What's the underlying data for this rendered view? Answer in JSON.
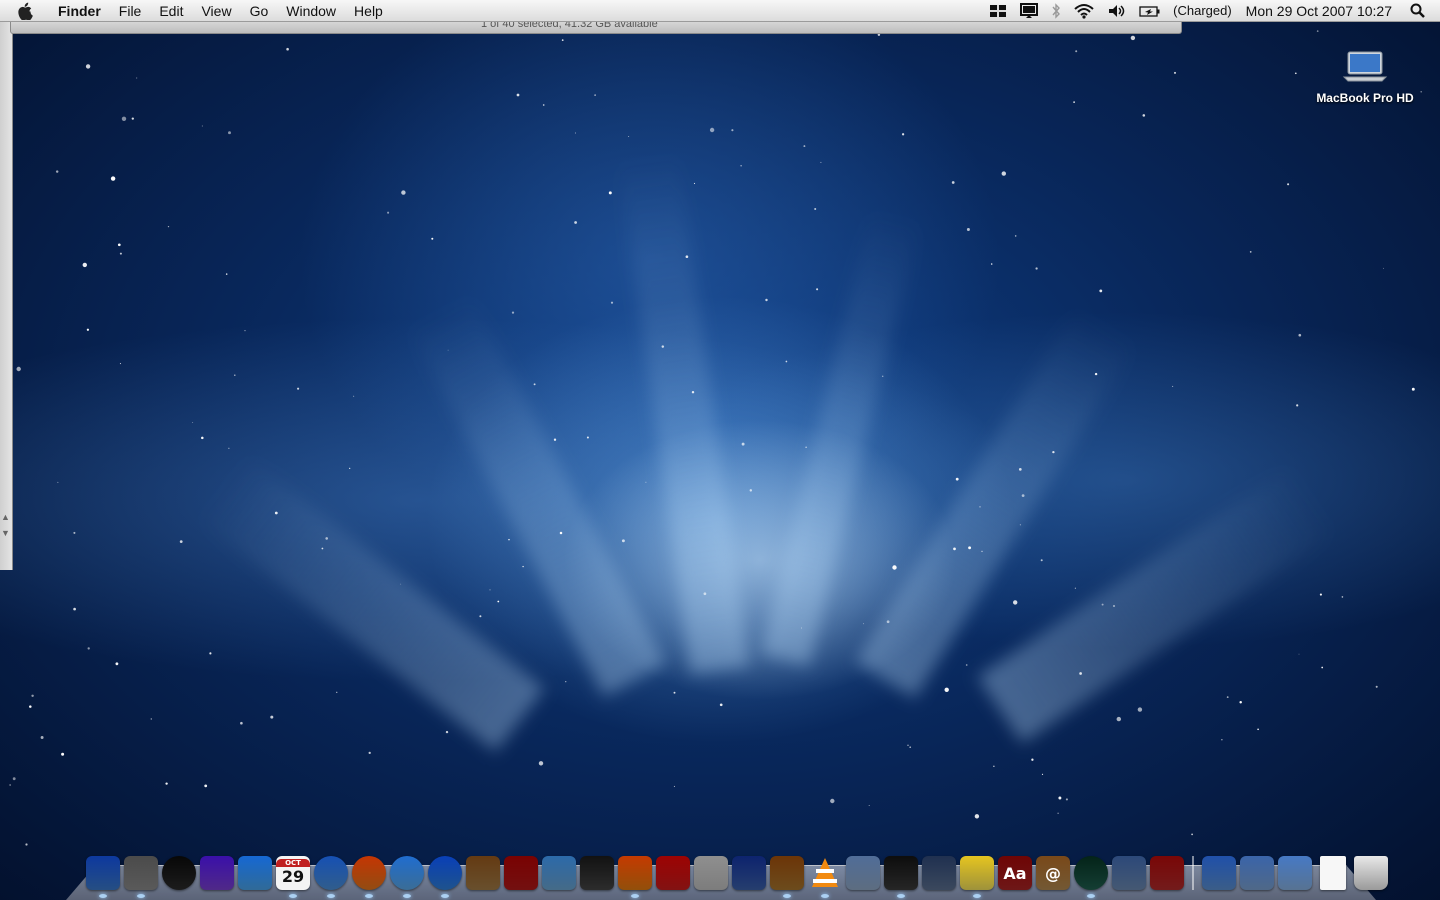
{
  "menubar": {
    "apple_icon": "apple-icon",
    "app_name": "Finder",
    "menus": [
      "File",
      "Edit",
      "View",
      "Go",
      "Window",
      "Help"
    ],
    "battery_status": "(Charged)",
    "clock": "Mon 29 Oct 2007 10:27",
    "status_icons": [
      "spaces-icon",
      "display-icon",
      "bluetooth-icon",
      "wifi-icon",
      "volume-icon",
      "battery-icon",
      "spotlight-icon"
    ]
  },
  "finder_window": {
    "status_text": "1 of 40 selected, 41.32 GB available"
  },
  "desktop": {
    "hd_label": "MacBook Pro HD"
  },
  "dock": {
    "calendar_day": "29",
    "calendar_month": "OCT",
    "dictionary_text": "Aa",
    "address_book_text": "@",
    "apps": [
      {
        "name": "finder-icon",
        "color": "#3a78c9"
      },
      {
        "name": "system-preferences-icon",
        "color": "#8a8a8a"
      },
      {
        "name": "dashboard-icon",
        "color": "#2b2b2b"
      },
      {
        "name": "app-e-icon",
        "color": "#7a3fd0"
      },
      {
        "name": "app-w-icon",
        "color": "#4aa3e8"
      },
      {
        "name": "ical-icon",
        "color": "#e8e8e8"
      },
      {
        "name": "safari-icon",
        "color": "#4b8fd6"
      },
      {
        "name": "firefox-icon",
        "color": "#e0751c"
      },
      {
        "name": "itunes-icon",
        "color": "#5aa7e6"
      },
      {
        "name": "quicktime-icon",
        "color": "#2f7fd8"
      },
      {
        "name": "iphoto-icon",
        "color": "#a07a45"
      },
      {
        "name": "photo-booth-icon",
        "color": "#b01818"
      },
      {
        "name": "preview-icon",
        "color": "#6aa4d0"
      },
      {
        "name": "final-cut-icon",
        "color": "#444444"
      },
      {
        "name": "front-row-icon",
        "color": "#e07a10"
      },
      {
        "name": "chair-app-icon",
        "color": "#c81c1c"
      },
      {
        "name": "dvd-player-icon",
        "color": "#bfbfbf"
      },
      {
        "name": "eye-app-icon",
        "color": "#3a5fa8"
      },
      {
        "name": "adium-icon",
        "color": "#a6742c"
      },
      {
        "name": "vlc-icon",
        "color": "#f28a10"
      },
      {
        "name": "dvd-studio-icon",
        "color": "#8fa7c5"
      },
      {
        "name": "imovie-icon",
        "color": "#3a3a3a"
      },
      {
        "name": "app-pause-icon",
        "color": "#5a6f8f"
      },
      {
        "name": "stickies-icon",
        "color": "#f2e05a"
      },
      {
        "name": "dictionary-icon",
        "color": "#a82424"
      },
      {
        "name": "address-book-icon",
        "color": "#b08850"
      },
      {
        "name": "time-machine-icon",
        "color": "#1f5f4f"
      },
      {
        "name": "photo-app-icon",
        "color": "#6a88b0"
      },
      {
        "name": "film-app-icon",
        "color": "#b02a2a"
      },
      {
        "name": "applications-folder-icon",
        "color": "#5a8fd0"
      },
      {
        "name": "documents-folder-icon",
        "color": "#7aa0d0"
      },
      {
        "name": "downloads-folder-icon",
        "color": "#86b0e0"
      },
      {
        "name": "document-icon",
        "color": "#f0f0f0"
      },
      {
        "name": "trash-icon",
        "color": "#c8c8c8"
      }
    ]
  }
}
